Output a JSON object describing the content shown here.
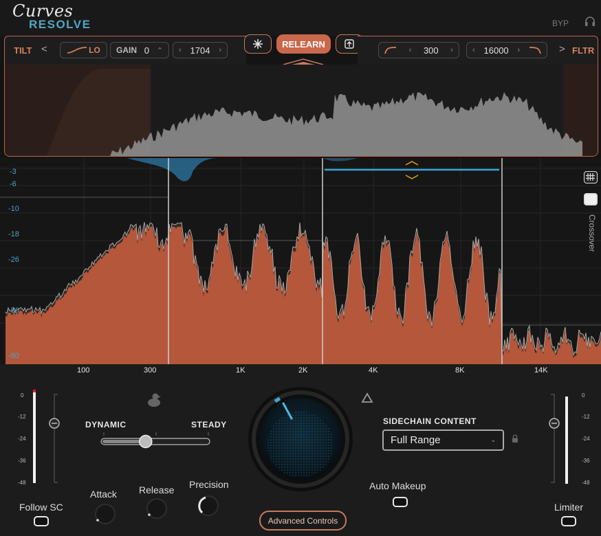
{
  "header": {
    "logo_line1": "Curves",
    "logo_line2": "RESOLVE",
    "bypass_label": "BYP",
    "headphones_icon": "headphones-icon"
  },
  "tilt": {
    "label": "TILT",
    "prev": "<",
    "shape_label": "LO",
    "gain_label": "GAIN",
    "gain_value": "0",
    "freq_value": "1704"
  },
  "center": {
    "freeze_icon": "snowflake-icon",
    "relearn_label": "RELEARN",
    "export_icon": "export-icon"
  },
  "filter": {
    "low_value": "300",
    "high_value": "16000",
    "next": ">",
    "label": "FLTR"
  },
  "display": {
    "db_labels": [
      "-3",
      "-6",
      "-10",
      "-18",
      "-26",
      "-50",
      "-80"
    ],
    "freq_labels": [
      "100",
      "300",
      "1K",
      "2K",
      "4K",
      "8K",
      "14K"
    ],
    "crossover_label": "Crossover",
    "grid_icon": "grid-icon"
  },
  "left_meter_ticks": [
    "0",
    "-12",
    "-24",
    "-36",
    "-48"
  ],
  "right_meter_ticks": [
    "0",
    "-12",
    "-24",
    "-36",
    "-48"
  ],
  "controls": {
    "dynamic_label": "DYNAMIC",
    "steady_label": "STEADY",
    "dynamic_steady_value": 0.4,
    "follow_sc_label": "Follow SC",
    "attack_label": "Attack",
    "release_label": "Release",
    "precision_label": "Precision",
    "advanced_label": "Advanced Controls",
    "sidechain_title": "SIDECHAIN CONTENT",
    "sidechain_value": "Full Range",
    "auto_makeup_label": "Auto Makeup",
    "limiter_label": "Limiter"
  },
  "colors": {
    "accent_orange": "#c9684a",
    "accent_blue": "#4fa7c4",
    "spectrum_fill": "#b5573b"
  }
}
